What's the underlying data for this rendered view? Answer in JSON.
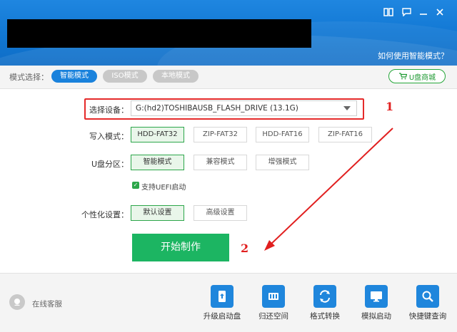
{
  "header": {
    "help_link": "如何使用智能模式？",
    "icons": [
      "book-icon",
      "chat-icon",
      "minimize-icon",
      "close-icon"
    ]
  },
  "mode_bar": {
    "label": "模式选择：",
    "tabs": [
      {
        "label": "智能模式",
        "active": true
      },
      {
        "label": "ISO模式",
        "active": false
      },
      {
        "label": "本地模式",
        "active": false
      }
    ],
    "shop_label": "U盘商城"
  },
  "form": {
    "device_label": "选择设备：",
    "device_value": "G:(hd2)TOSHIBAUSB_FLASH_DRIVE (13.1G)",
    "write_label": "写入模式：",
    "write_options": [
      "HDD-FAT32",
      "ZIP-FAT32",
      "HDD-FAT16",
      "ZIP-FAT16"
    ],
    "partition_label": "U盘分区：",
    "partition_options": [
      "智能模式",
      "兼容模式",
      "增强模式"
    ],
    "uefi_label": "支持UEFI启动",
    "custom_label": "个性化设置：",
    "custom_options": [
      "默认设置",
      "高级设置"
    ],
    "start_label": "开始制作"
  },
  "annotations": {
    "one": "1",
    "two": "2"
  },
  "bottom": {
    "service_label": "在线客服",
    "tools": [
      {
        "label": "升级启动盘",
        "icon": "upgrade-disk-icon"
      },
      {
        "label": "归还空间",
        "icon": "restore-space-icon"
      },
      {
        "label": "格式转换",
        "icon": "format-convert-icon"
      },
      {
        "label": "模拟启动",
        "icon": "simulate-boot-icon"
      },
      {
        "label": "快捷键查询",
        "icon": "hotkey-search-icon"
      }
    ]
  },
  "colors": {
    "accent": "#1a82dc",
    "green": "#1cb562",
    "annotation": "#e52a2a"
  }
}
